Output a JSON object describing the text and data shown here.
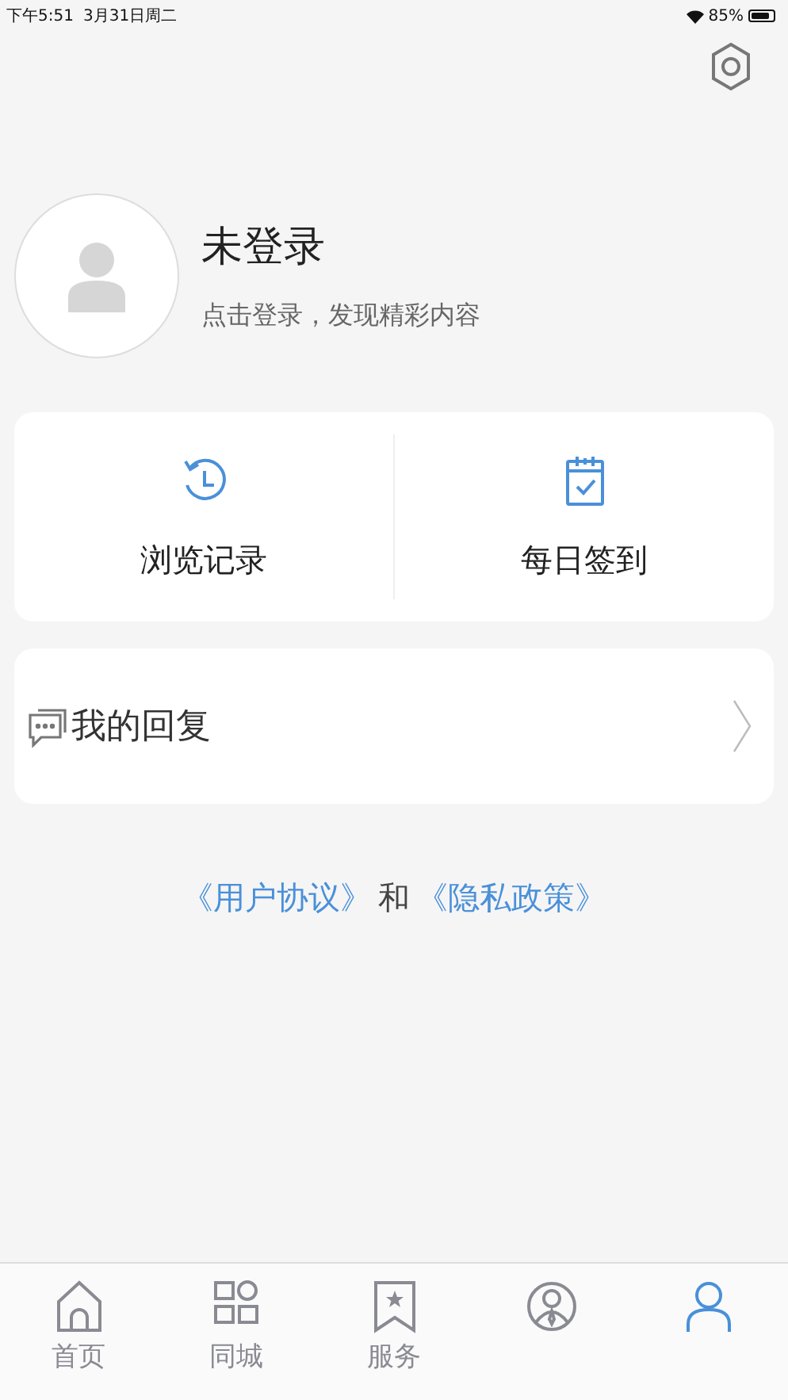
{
  "status_bar": {
    "time": "下午5:51",
    "date": "3月31日周二",
    "battery_text": "85%"
  },
  "profile": {
    "name": "未登录",
    "hint": "点击登录，发现精彩内容"
  },
  "shortcuts": [
    {
      "label": "浏览记录"
    },
    {
      "label": "每日签到"
    }
  ],
  "menu": [
    {
      "label": "我的回复"
    }
  ],
  "policy": {
    "link_1": "《用户协议》",
    "joiner": "和",
    "link_2": "《隐私政策》"
  },
  "tabs": [
    {
      "label": "首页",
      "selected": false
    },
    {
      "label": "同城",
      "selected": false
    },
    {
      "label": "服务",
      "selected": false
    },
    {
      "selected": false
    },
    {
      "selected": true
    }
  ]
}
